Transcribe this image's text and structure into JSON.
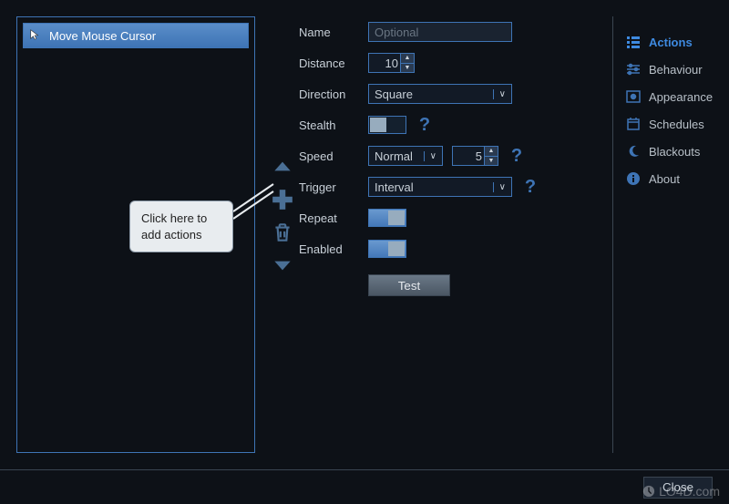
{
  "actions_list": {
    "items": [
      {
        "label": "Move Mouse Cursor"
      }
    ]
  },
  "form": {
    "name": {
      "label": "Name",
      "placeholder": "Optional",
      "value": ""
    },
    "distance": {
      "label": "Distance",
      "value": "10"
    },
    "direction": {
      "label": "Direction",
      "value": "Square"
    },
    "stealth": {
      "label": "Stealth",
      "on": false
    },
    "speed": {
      "label": "Speed",
      "value": "Normal",
      "numeric": "5"
    },
    "trigger": {
      "label": "Trigger",
      "value": "Interval"
    },
    "repeat": {
      "label": "Repeat",
      "on": true
    },
    "enabled": {
      "label": "Enabled",
      "on": true
    },
    "test_label": "Test"
  },
  "tooltip": {
    "text": "Click here to add actions"
  },
  "nav": {
    "actions": "Actions",
    "behaviour": "Behaviour",
    "appearance": "Appearance",
    "schedules": "Schedules",
    "blackouts": "Blackouts",
    "about": "About"
  },
  "buttons": {
    "close": "Close"
  },
  "watermark": "LO4D.com"
}
